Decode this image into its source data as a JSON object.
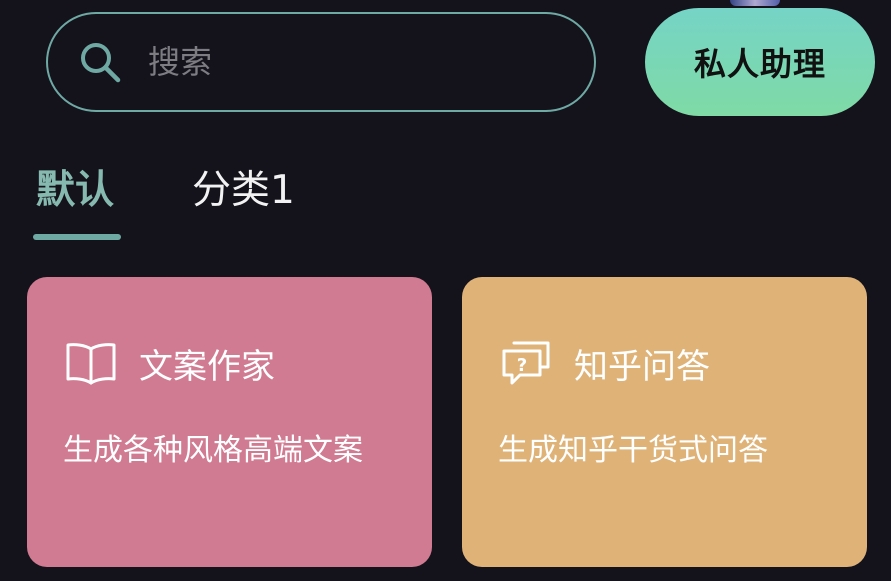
{
  "search": {
    "placeholder": "搜索"
  },
  "header": {
    "assistant_label": "私人助理"
  },
  "tabs": [
    {
      "label": "默认",
      "active": true
    },
    {
      "label": "分类1",
      "active": false
    }
  ],
  "cards": [
    {
      "icon": "open-book-icon",
      "title": "文案作家",
      "description": "生成各种风格高端文案",
      "color": "#d07b91"
    },
    {
      "icon": "chat-question-icon",
      "title": "知乎问答",
      "description": "生成知乎干货式问答",
      "color": "#dfb378"
    }
  ],
  "colors": {
    "background": "#14131c",
    "accent": "#6fa9a3"
  }
}
